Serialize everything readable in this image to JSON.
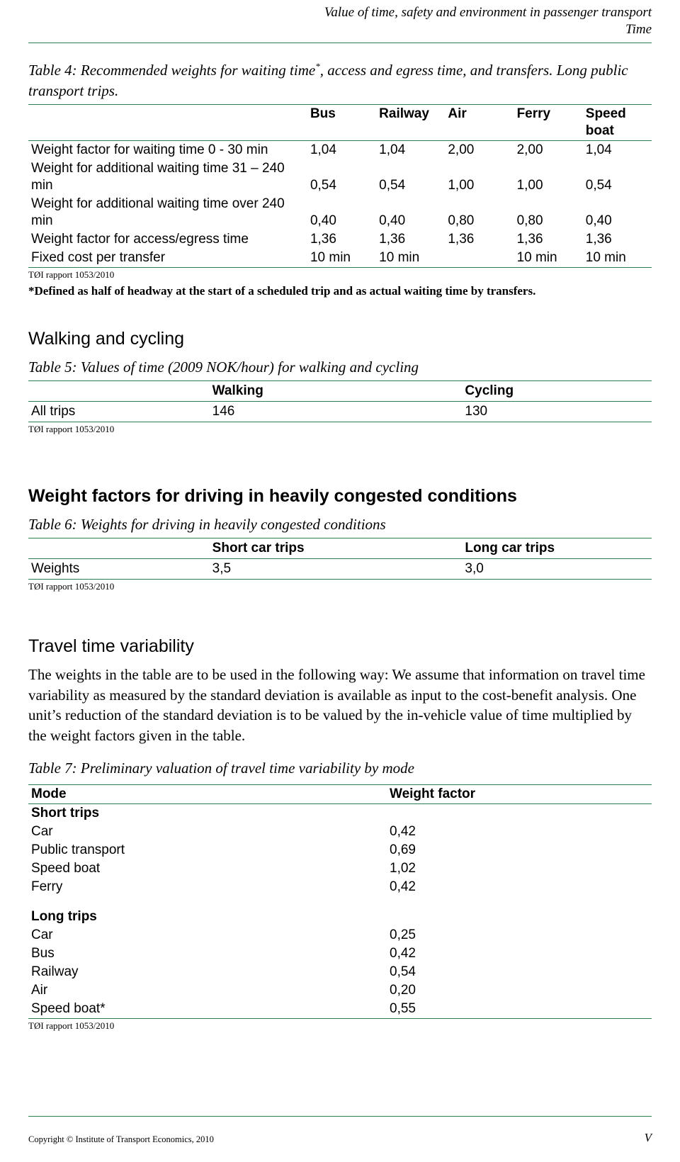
{
  "running_header": {
    "line1": "Value of time, safety and environment in passenger transport",
    "line2": "Time"
  },
  "table4": {
    "caption_part1": "Table 4: Recommended weights for waiting time",
    "caption_star": "*",
    "caption_part2": ", access and egress time, and transfers. Long public transport trips.",
    "columns": [
      "",
      "Bus",
      "Railway",
      "Air",
      "Ferry",
      "Speed boat"
    ],
    "col_speedboat_line1": "Speed",
    "col_speedboat_line2": "boat",
    "rows": [
      {
        "label": "Weight factor for waiting time 0 - 30 min",
        "values": [
          "1,04",
          "1,04",
          "2,00",
          "2,00",
          "1,04"
        ]
      },
      {
        "label": "Weight for additional waiting time 31 – 240 min",
        "values": [
          "0,54",
          "0,54",
          "1,00",
          "1,00",
          "0,54"
        ]
      },
      {
        "label": "Weight for additional waiting time over 240 min",
        "values": [
          "0,40",
          "0,40",
          "0,80",
          "0,80",
          "0,40"
        ]
      },
      {
        "label": "Weight factor for access/egress time",
        "values": [
          "1,36",
          "1,36",
          "1,36",
          "1,36",
          "1,36"
        ]
      },
      {
        "label": "Fixed cost per transfer",
        "values": [
          "10 min",
          "10 min",
          "",
          "10 min",
          "10 min"
        ]
      }
    ],
    "source": "TØI rapport 1053/2010",
    "footnote": "*Defined as half of headway at the start of a scheduled trip and as actual waiting time by transfers."
  },
  "section_walking": {
    "heading": "Walking and cycling",
    "caption": "Table 5: Values of time (2009 NOK/hour) for walking and cycling",
    "columns": [
      "",
      "Walking",
      "Cycling"
    ],
    "rows": [
      {
        "label": "All trips",
        "values": [
          "146",
          "130"
        ]
      }
    ],
    "source": "TØI rapport 1053/2010"
  },
  "section_congestion": {
    "heading": "Weight factors for driving in heavily congested conditions",
    "caption": "Table 6: Weights for driving in heavily congested conditions",
    "columns": [
      "",
      "Short car trips",
      "Long car trips"
    ],
    "rows": [
      {
        "label": "Weights",
        "values": [
          "3,5",
          "3,0"
        ]
      }
    ],
    "source": "TØI rapport 1053/2010"
  },
  "section_variability": {
    "heading": "Travel time variability",
    "paragraph": "The weights in the table are to be used in the following way: We assume that information on travel time variability as measured by the standard deviation is available as input to the cost-benefit analysis. One unit’s reduction of the standard deviation is to be valued by the in-vehicle value of time multiplied by the weight factors given in the table.",
    "caption": "Table 7: Preliminary valuation of travel time variability by mode",
    "columns": [
      "Mode",
      "Weight factor"
    ],
    "group_short": "Short trips",
    "rows_short": [
      {
        "label": "Car",
        "value": "0,42"
      },
      {
        "label": "Public transport",
        "value": "0,69"
      },
      {
        "label": "Speed boat",
        "value": "1,02"
      },
      {
        "label": "Ferry",
        "value": "0,42"
      }
    ],
    "group_long": "Long trips",
    "rows_long": [
      {
        "label": "Car",
        "value": "0,25"
      },
      {
        "label": "Bus",
        "value": "0,42"
      },
      {
        "label": "Railway",
        "value": "0,54"
      },
      {
        "label": "Air",
        "value": "0,20"
      },
      {
        "label": "Speed boat*",
        "value": "0,55"
      }
    ],
    "source": "TØI rapport 1053/2010"
  },
  "footer": {
    "copyright": "Copyright © Institute of Transport Economics, 2010",
    "page_number": "V"
  },
  "colors": {
    "rule": "#2e7d4f"
  }
}
